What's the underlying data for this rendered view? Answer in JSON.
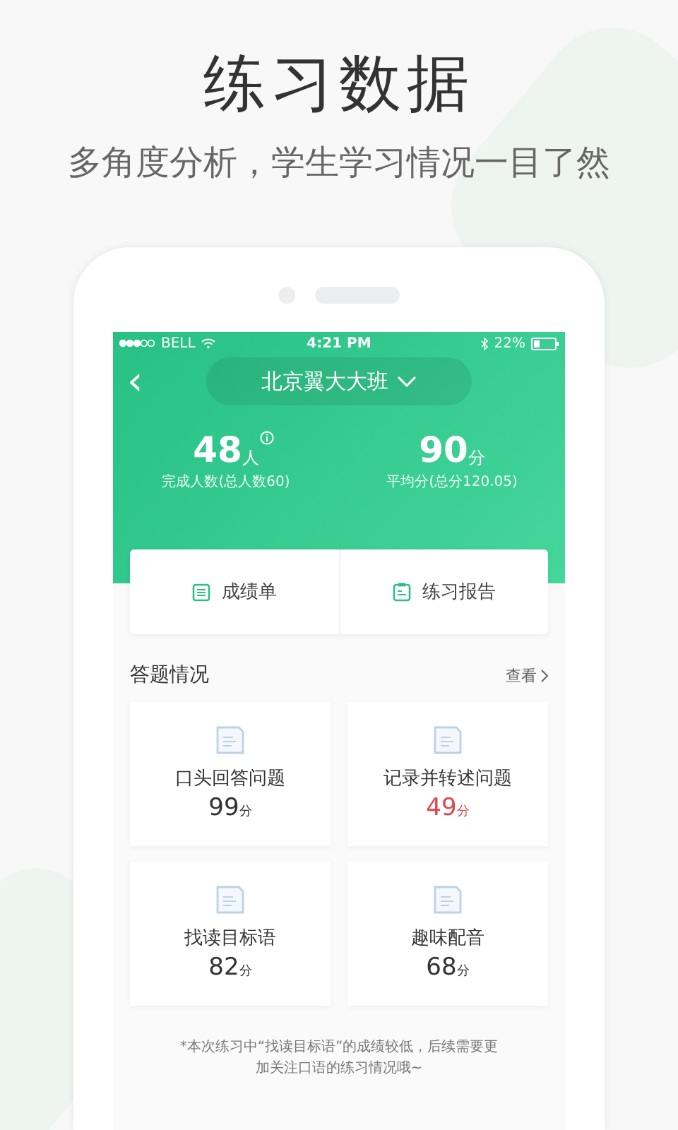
{
  "headline": "练习数据",
  "subtitle": "多角度分析，学生学习情况一目了然",
  "status_bar": {
    "carrier": "BELL",
    "time": "4:21 PM",
    "battery": "22%"
  },
  "nav": {
    "back": "‹",
    "class_name": "北京翼大大班"
  },
  "stats": [
    {
      "value": "48",
      "unit": "人",
      "info": true,
      "label": "完成人数(总人数60)"
    },
    {
      "value": "90",
      "unit": "分",
      "label": "平均分(总分120.05)"
    }
  ],
  "actions": [
    {
      "kind": "list",
      "label": "成绩单"
    },
    {
      "kind": "clipboard",
      "label": "练习报告"
    }
  ],
  "section": {
    "title": "答题情况",
    "more": "查看"
  },
  "tasks": [
    {
      "name": "口头回答问题",
      "score": "99",
      "unit": "分",
      "low": false
    },
    {
      "name": "记录并转述问题",
      "score": "49",
      "unit": "分",
      "low": true
    },
    {
      "name": "找读目标语",
      "score": "82",
      "unit": "分",
      "low": false
    },
    {
      "name": "趣味配音",
      "score": "68",
      "unit": "分",
      "low": false
    }
  ],
  "note": "*本次练习中“找读目标语”的成绩较低，后续需要更加关注口语的练习情况哦~"
}
